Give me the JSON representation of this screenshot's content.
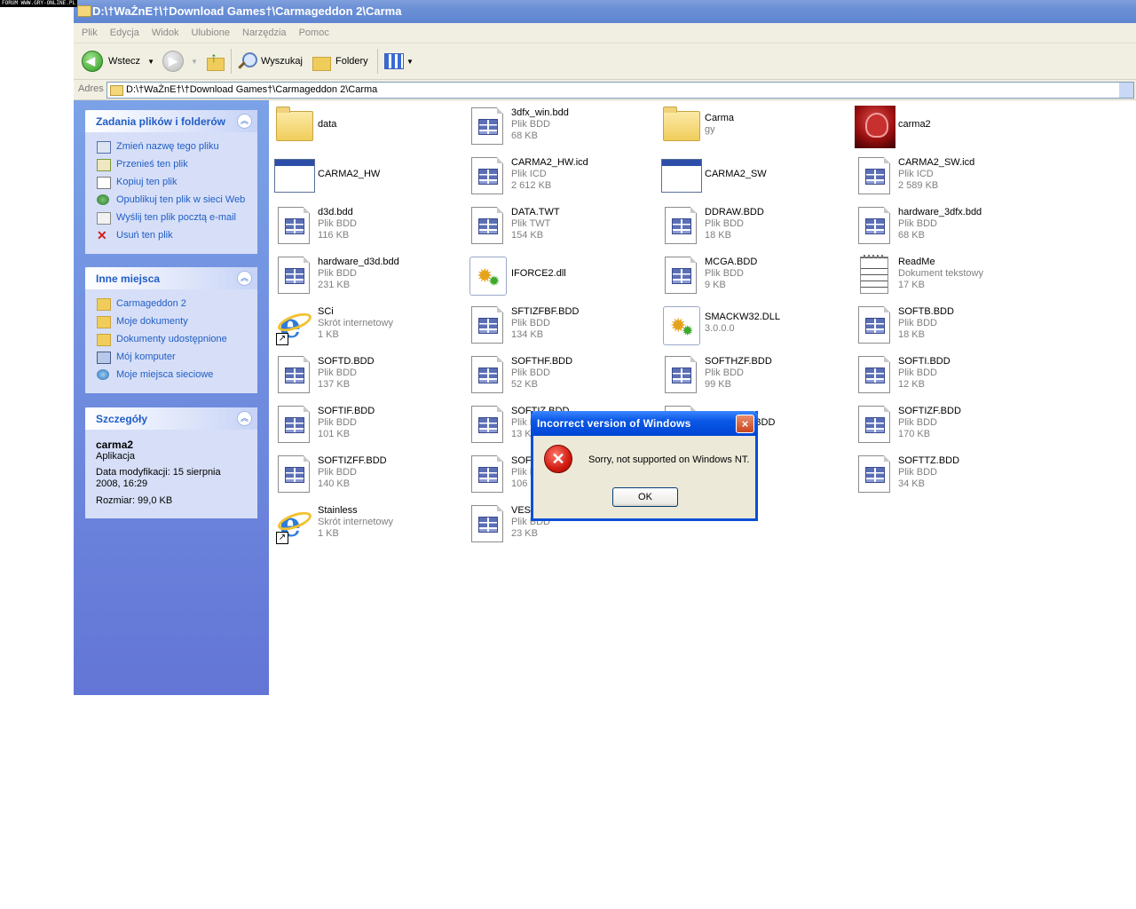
{
  "watermark": "FORUM WWW.GRY-ONLINE.PL",
  "window": {
    "title": "D:\\†WaŻnE†\\†Download Games†\\Carmageddon 2\\Carma",
    "menu": [
      "Plik",
      "Edycja",
      "Widok",
      "Ulubione",
      "Narzędzia",
      "Pomoc"
    ],
    "toolbar": {
      "back": "Wstecz",
      "search": "Wyszukaj",
      "folders": "Foldery"
    },
    "address": {
      "label": "Adres",
      "value": "D:\\†WaŻnE†\\†Download Games†\\Carmageddon 2\\Carma"
    }
  },
  "sidebar": {
    "tasks": {
      "title": "Zadania plików i folderów",
      "items": [
        {
          "label": "Zmień nazwę tego pliku",
          "icon": "rename-icon"
        },
        {
          "label": "Przenieś ten plik",
          "icon": "move-icon"
        },
        {
          "label": "Kopiuj ten plik",
          "icon": "copy-icon"
        },
        {
          "label": "Opublikuj ten plik w sieci Web",
          "icon": "publish-web-icon"
        },
        {
          "label": "Wyślij ten plik pocztą e-mail",
          "icon": "email-icon"
        },
        {
          "label": "Usuń ten plik",
          "icon": "delete-icon"
        }
      ]
    },
    "places": {
      "title": "Inne miejsca",
      "items": [
        {
          "label": "Carmageddon 2",
          "icon": "folder-icon"
        },
        {
          "label": "Moje dokumenty",
          "icon": "folder-icon"
        },
        {
          "label": "Dokumenty udostępnione",
          "icon": "folder-icon"
        },
        {
          "label": "Mój komputer",
          "icon": "computer-icon"
        },
        {
          "label": "Moje miejsca sieciowe",
          "icon": "network-icon"
        }
      ]
    },
    "details": {
      "title": "Szczegóły",
      "name": "carma2",
      "type": "Aplikacja",
      "modified": "Data modyfikacji: 15 sierpnia 2008, 16:29",
      "size": "Rozmiar: 99,0 KB"
    }
  },
  "files": [
    {
      "name": "data",
      "line2": "",
      "line3": "",
      "icon": "folder"
    },
    {
      "name": "3dfx_win.bdd",
      "line2": "Plik BDD",
      "line3": "68 KB",
      "icon": "doc"
    },
    {
      "name": "Carma",
      "line2": "gy",
      "line3": "",
      "icon": "folder"
    },
    {
      "name": "carma2",
      "line2": "",
      "line3": "",
      "icon": "carma"
    },
    {
      "name": "CARMA2_HW",
      "line2": "",
      "line3": "",
      "icon": "appwin"
    },
    {
      "name": "CARMA2_HW.icd",
      "line2": "Plik ICD",
      "line3": "2 612 KB",
      "icon": "doc"
    },
    {
      "name": "CARMA2_SW",
      "line2": "",
      "line3": "",
      "icon": "appwin"
    },
    {
      "name": "CARMA2_SW.icd",
      "line2": "Plik ICD",
      "line3": "2 589 KB",
      "icon": "doc"
    },
    {
      "name": "d3d.bdd",
      "line2": "Plik BDD",
      "line3": "116 KB",
      "icon": "doc"
    },
    {
      "name": "DATA.TWT",
      "line2": "Plik TWT",
      "line3": "154 KB",
      "icon": "doc"
    },
    {
      "name": "DDRAW.BDD",
      "line2": "Plik BDD",
      "line3": "18 KB",
      "icon": "doc"
    },
    {
      "name": "hardware_3dfx.bdd",
      "line2": "Plik BDD",
      "line3": "68 KB",
      "icon": "doc"
    },
    {
      "name": "hardware_d3d.bdd",
      "line2": "Plik BDD",
      "line3": "231 KB",
      "icon": "doc"
    },
    {
      "name": "IFORCE2.dll",
      "line2": "",
      "line3": "",
      "icon": "dll"
    },
    {
      "name": "MCGA.BDD",
      "line2": "Plik BDD",
      "line3": "9 KB",
      "icon": "doc"
    },
    {
      "name": "ReadMe",
      "line2": "Dokument tekstowy",
      "line3": "17 KB",
      "icon": "text"
    },
    {
      "name": "SCi",
      "line2": "Skrót internetowy",
      "line3": "1 KB",
      "icon": "ie"
    },
    {
      "name": "SFTIZFBF.BDD",
      "line2": "Plik BDD",
      "line3": "134 KB",
      "icon": "doc"
    },
    {
      "name": "SMACKW32.DLL",
      "line2": "3.0.0.0",
      "line3": "",
      "icon": "dll"
    },
    {
      "name": "SOFTB.BDD",
      "line2": "Plik BDD",
      "line3": "18 KB",
      "icon": "doc"
    },
    {
      "name": "SOFTD.BDD",
      "line2": "Plik BDD",
      "line3": "137 KB",
      "icon": "doc"
    },
    {
      "name": "SOFTHF.BDD",
      "line2": "Plik BDD",
      "line3": "52 KB",
      "icon": "doc"
    },
    {
      "name": "SOFTHZF.BDD",
      "line2": "Plik BDD",
      "line3": "99 KB",
      "icon": "doc"
    },
    {
      "name": "SOFTI.BDD",
      "line2": "Plik BDD",
      "line3": "12 KB",
      "icon": "doc"
    },
    {
      "name": "SOFTIF.BDD",
      "line2": "Plik BDD",
      "line3": "101 KB",
      "icon": "doc"
    },
    {
      "name": "SOFTIZ.BDD",
      "line2": "Plik BDD",
      "line3": "13 KB",
      "icon": "doc"
    },
    {
      "name": "SOFTIZFB.BDD",
      "line2": "",
      "line3": "",
      "icon": "doc"
    },
    {
      "name": "SOFTIZF.BDD",
      "line2": "Plik BDD",
      "line3": "170 KB",
      "icon": "doc"
    },
    {
      "name": "SOFTIZFF.BDD",
      "line2": "Plik BDD",
      "line3": "140 KB",
      "icon": "doc"
    },
    {
      "name": "SOFTIZFFB.BDD",
      "line2": "Plik BDD",
      "line3": "106 KB",
      "icon": "doc"
    },
    {
      "name": "",
      "line2": "",
      "line3": "",
      "icon": "none"
    },
    {
      "name": "SOFTTZ.BDD",
      "line2": "Plik BDD",
      "line3": "34 KB",
      "icon": "doc"
    },
    {
      "name": "Stainless",
      "line2": "Skrót internetowy",
      "line3": "1 KB",
      "icon": "ie"
    },
    {
      "name": "VESA.BDD",
      "line2": "Plik BDD",
      "line3": "23 KB",
      "icon": "doc"
    }
  ],
  "dialog": {
    "title": "Incorrect version of Windows",
    "message": "Sorry, not supported on Windows NT.",
    "ok": "OK",
    "close": "×",
    "icon": "error-icon"
  }
}
